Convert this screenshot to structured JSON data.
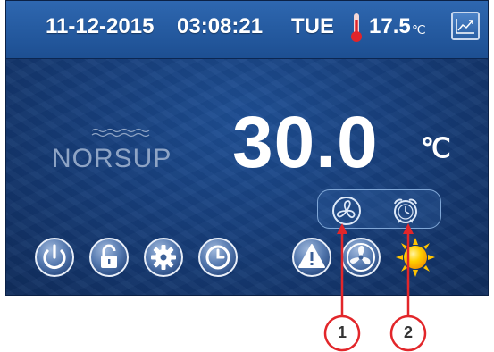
{
  "status_bar": {
    "date": "11-12-2015",
    "time": "03:08:21",
    "day": "TUE",
    "room_temp": "17.5",
    "room_temp_unit": "℃"
  },
  "logo": {
    "text": "NORSUP"
  },
  "main": {
    "water_temp": "30.0",
    "water_temp_unit": "℃"
  },
  "status_icons": [
    {
      "name": "fan-status-icon"
    },
    {
      "name": "alarm-clock-status-icon"
    }
  ],
  "bottom_buttons": [
    {
      "name": "power-icon"
    },
    {
      "name": "unlock-icon"
    },
    {
      "name": "gear-icon"
    },
    {
      "name": "clock-icon"
    },
    {
      "name": "warning-icon"
    },
    {
      "name": "fan-icon"
    },
    {
      "name": "sun-icon"
    }
  ],
  "callouts": [
    "1",
    "2"
  ],
  "colors": {
    "screen_bg": "#173f7c",
    "callout_red": "#e2262a",
    "sun_yellow": "#ffcc00"
  }
}
